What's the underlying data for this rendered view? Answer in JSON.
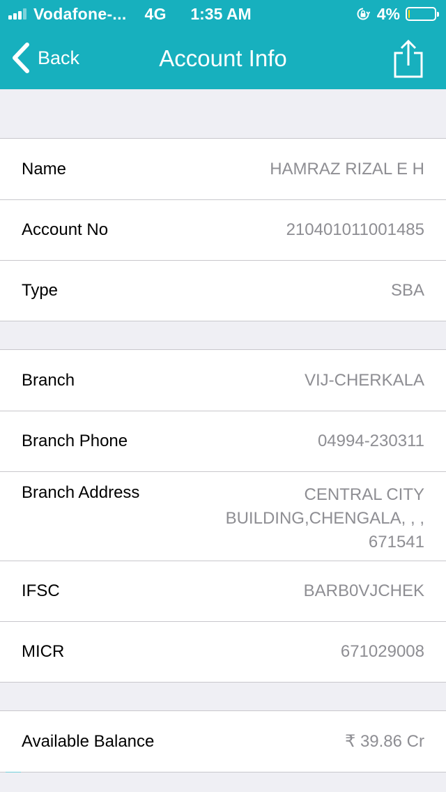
{
  "status_bar": {
    "carrier": "Vodafone-...",
    "network": "4G",
    "time": "1:35 AM",
    "battery": "4%",
    "battery_level": 0.04
  },
  "nav": {
    "back_label": "Back",
    "title": "Account Info",
    "back_icon": "chevron-left-icon",
    "share_icon": "share-icon"
  },
  "colors": {
    "header": "#17b0be",
    "background": "#efeff4",
    "value_text": "#8e8e93"
  },
  "groups": [
    {
      "rows": [
        {
          "label": "Name",
          "value": "HAMRAZ RIZAL E H"
        },
        {
          "label": "Account No",
          "value": "210401011001485"
        },
        {
          "label": "Type",
          "value": "SBA"
        }
      ]
    },
    {
      "rows": [
        {
          "label": "Branch",
          "value": "VIJ-CHERKALA"
        },
        {
          "label": "Branch Phone",
          "value": "04994-230311"
        },
        {
          "label": "Branch Address",
          "value": "CENTRAL CITY BUILDING,CHENGALA, , , 671541"
        },
        {
          "label": "IFSC",
          "value": "BARB0VJCHEK"
        },
        {
          "label": "MICR",
          "value": "671029008"
        }
      ]
    },
    {
      "rows": [
        {
          "label": "Available Balance",
          "value": "₹ 39.86 Cr"
        }
      ]
    }
  ]
}
